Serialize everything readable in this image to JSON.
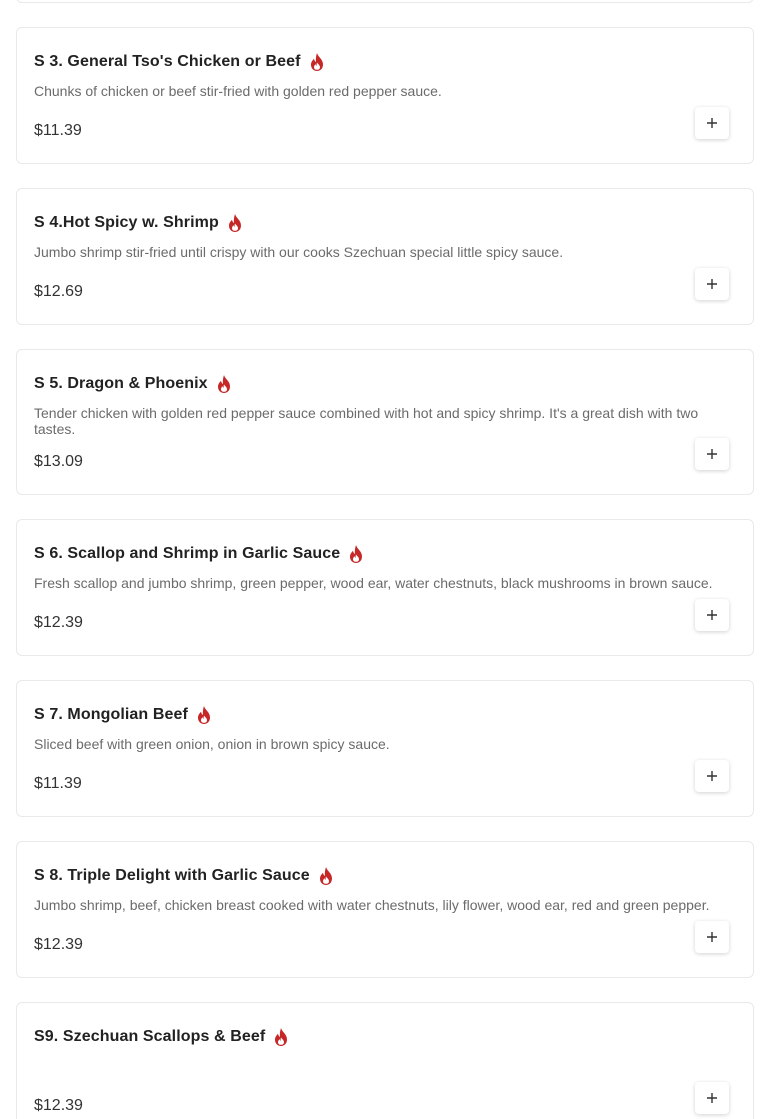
{
  "colors": {
    "flame": "#c62828",
    "card_border": "#e9e9e9",
    "desc": "#6b6b6b"
  },
  "items": [
    {
      "name": "S 3. General Tso's Chicken or Beef",
      "spicy": true,
      "description": "Chunks of chicken or beef stir-fried with golden red pepper sauce.",
      "price": "$11.39",
      "add_icon": "plus-icon"
    },
    {
      "name": "S 4.Hot Spicy w. Shrimp",
      "spicy": true,
      "description": "Jumbo shrimp stir-fried until crispy with our cooks Szechuan special little spicy sauce.",
      "price": "$12.69",
      "add_icon": "plus-icon"
    },
    {
      "name": "S 5. Dragon & Phoenix",
      "spicy": true,
      "description": "Tender chicken with golden red pepper sauce combined with hot and spicy shrimp. It's a great dish with two tastes.",
      "price": "$13.09",
      "add_icon": "plus-icon"
    },
    {
      "name": "S 6. Scallop and Shrimp in Garlic Sauce",
      "spicy": true,
      "description": "Fresh scallop and jumbo shrimp, green pepper, wood ear, water chestnuts, black mushrooms in brown sauce.",
      "price": "$12.39",
      "add_icon": "plus-icon"
    },
    {
      "name": "S 7. Mongolian Beef",
      "spicy": true,
      "description": "Sliced beef with green onion, onion in brown spicy sauce.",
      "price": "$11.39",
      "add_icon": "plus-icon"
    },
    {
      "name": "S 8. Triple Delight with Garlic Sauce",
      "spicy": true,
      "description": "Jumbo shrimp, beef, chicken breast cooked with water chestnuts, lily flower, wood ear, red and green pepper.",
      "price": "$12.39",
      "add_icon": "plus-icon"
    },
    {
      "name": "S9. Szechuan Scallops & Beef",
      "spicy": true,
      "description": "",
      "price": "$12.39",
      "add_icon": "plus-icon"
    }
  ]
}
